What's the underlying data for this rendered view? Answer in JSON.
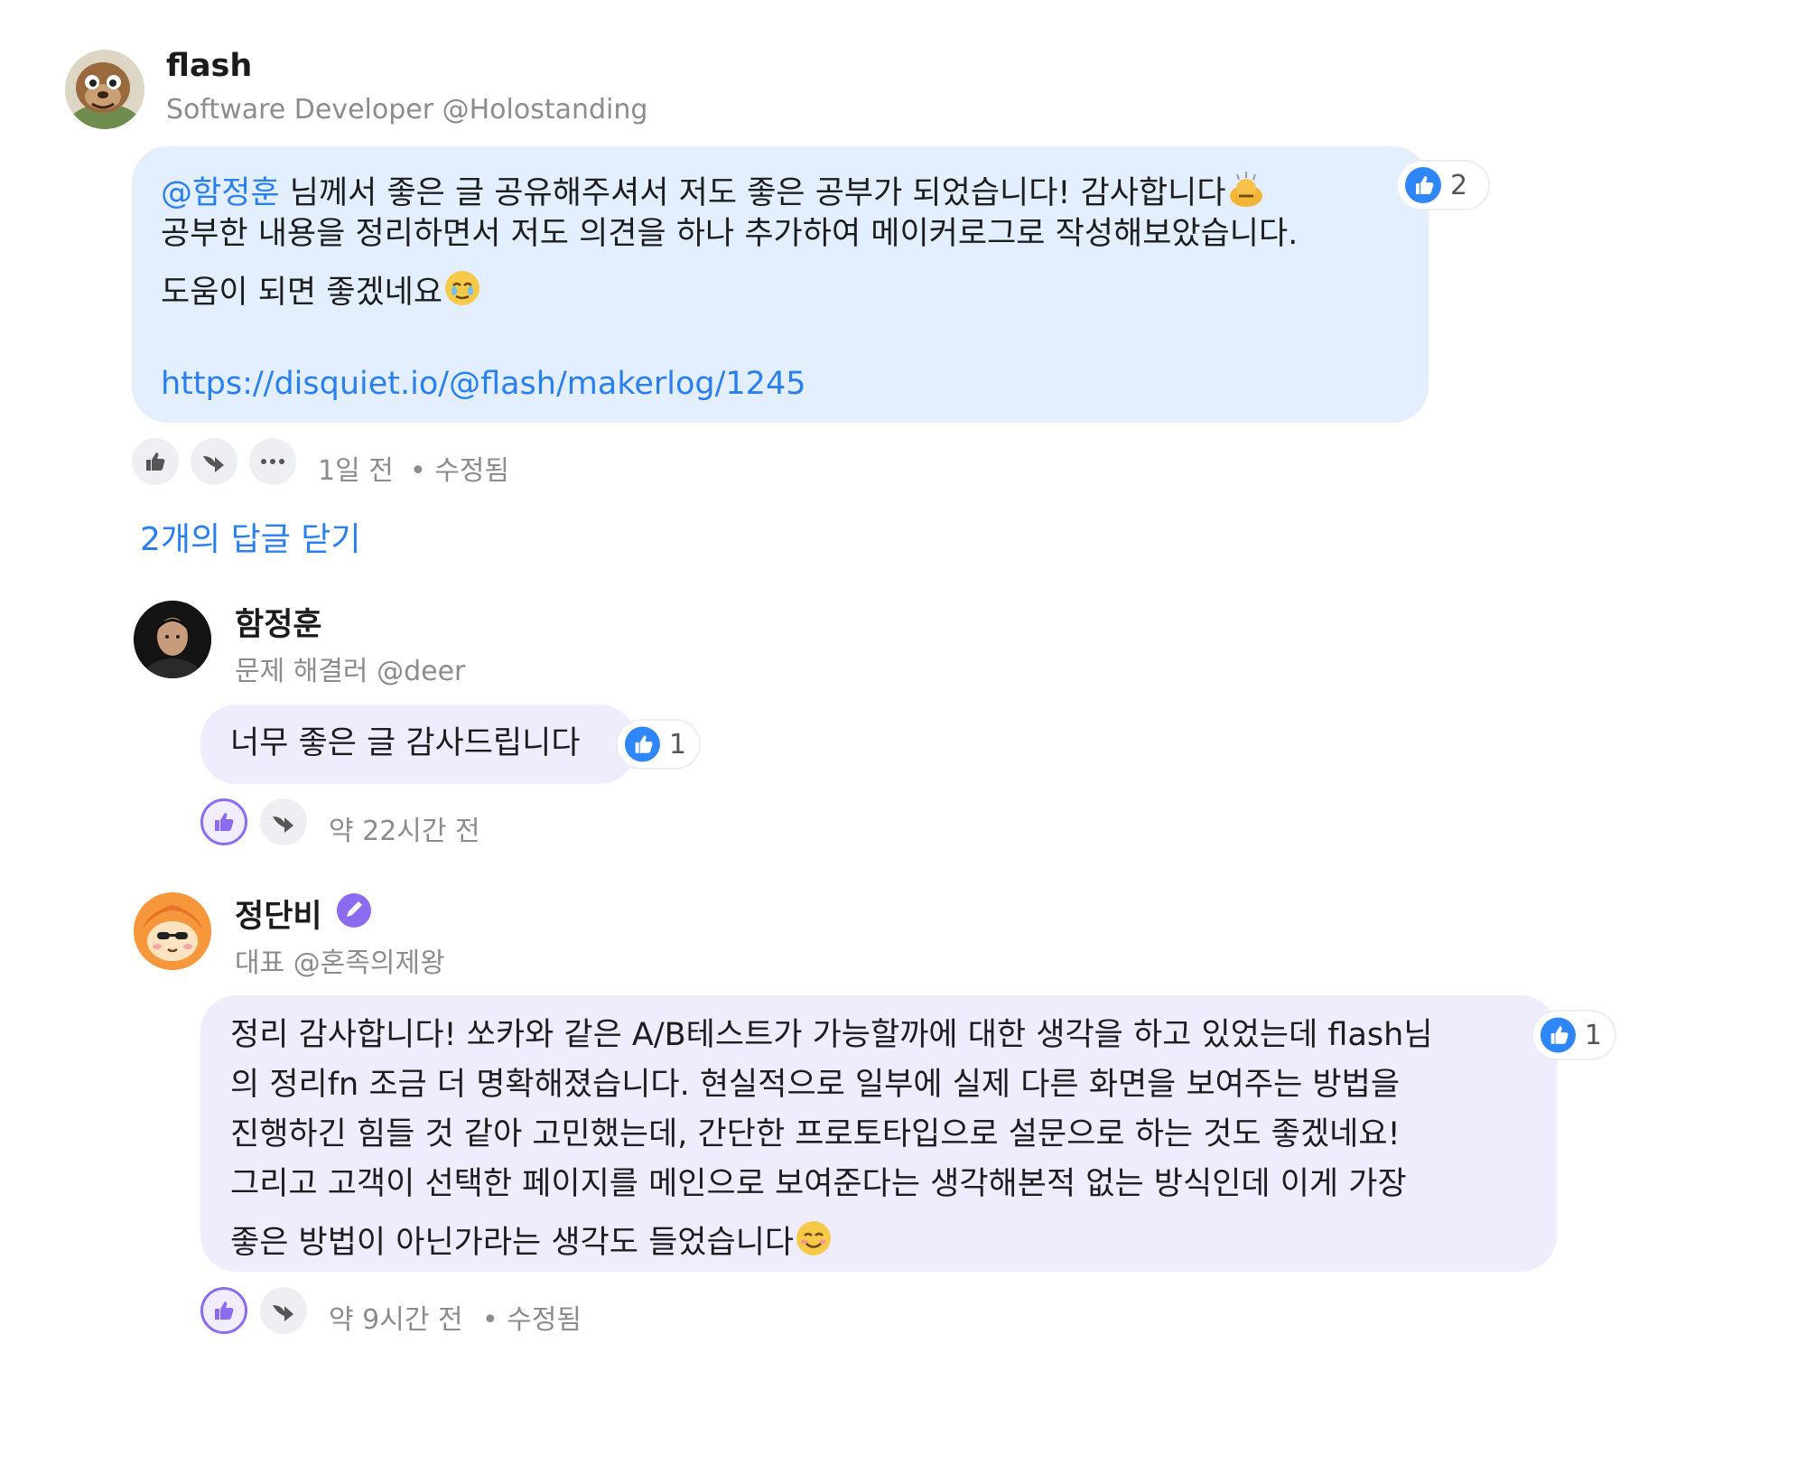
{
  "thread": {
    "comment": {
      "author": "flash",
      "subtitle": "Software Developer @Holostanding",
      "mention": "@함정훈",
      "line1_text": " 님께서 좋은 글 공유해주셔서 저도 좋은 공부가 되었습니다! 감사합니다",
      "line2": "공부한 내용을 정리하면서 저도 의견을 하나 추가하여 메이커로그로 작성해보았습니다.",
      "line3": "도움이 되면 좋겠네요",
      "link": "https://disquiet.io/@flash/makerlog/1245",
      "reaction_count": "2",
      "time": "1일 전",
      "edited": "• 수정됨"
    },
    "replies_toggle": "2개의 답글 닫기",
    "replies": [
      {
        "author": "함정훈",
        "subtitle": "문제 해결러 @deer",
        "text": "너무 좋은 글 감사드립니다",
        "reaction_count": "1",
        "time": "약 22시간 전"
      },
      {
        "author": "정단비",
        "verified": true,
        "subtitle": "대표 @혼족의제왕",
        "lines": [
          "정리 감사합니다! 쏘카와 같은 A/B테스트가 가능할까에 대한 생각을 하고 있었는데 flash님",
          "의 정리fn 조금 더 명확해졌습니다. 현실적으로 일부에 실제 다른 화면을 보여주는 방법을",
          "진행하긴 힘들 것 같아 고민했는데, 간단한 프로토타입으로 설문으로 하는 것도 좋겠네요!",
          "그리고 고객이 선택한 페이지를 메인으로 보여준다는 생각해본적 없는 방식인데 이게 가장",
          "좋은 방법이 아닌가라는 생각도 들었습니다"
        ],
        "reaction_count": "1",
        "time": "약 9시간 전",
        "edited": "• 수정됨"
      }
    ]
  },
  "colors": {
    "comment_bubble": "#e3efff",
    "reply_bubble": "#efecfd",
    "link": "#2a7ff0",
    "reaction_icon": "#2f86f6",
    "liked_accent": "#8b6cf0"
  },
  "icons": {
    "reaction": "thumbs-up-badge-icon",
    "like": "thumbs-up-icon",
    "share": "share-arrow-icon",
    "more": "more-dots-icon",
    "verified": "verified-pen-icon",
    "bow_emoji": "bowing-person-emoji",
    "teary_emoji": "teary-smile-emoji",
    "smile_emoji": "smiling-face-emoji"
  }
}
